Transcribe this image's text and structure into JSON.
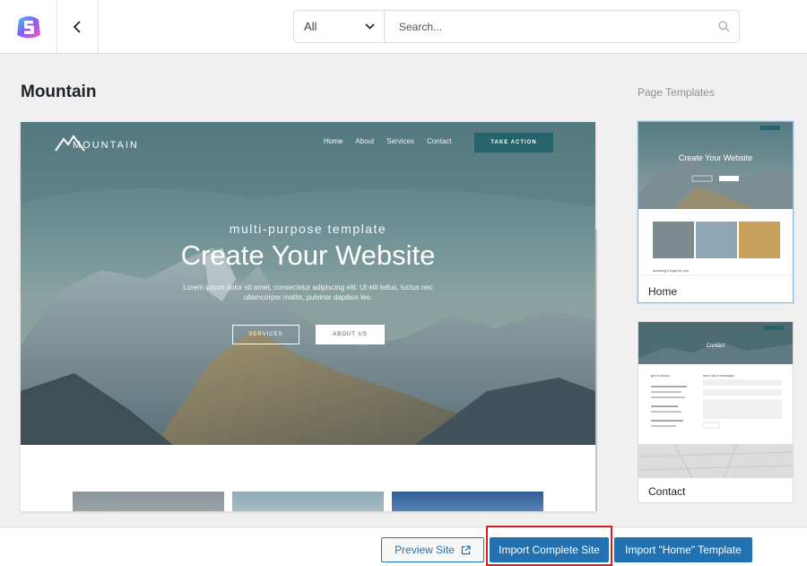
{
  "toolbar": {
    "filter": {
      "selected": "All"
    },
    "search": {
      "placeholder": "Search..."
    }
  },
  "page_title": "Mountain",
  "sidebar": {
    "heading": "Page Templates",
    "templates": [
      {
        "label": "Home",
        "selected": true
      },
      {
        "label": "Contact",
        "selected": false
      }
    ]
  },
  "preview": {
    "logo_text": "MOUNTAIN",
    "nav": [
      "Home",
      "About",
      "Services",
      "Contact"
    ],
    "cta": "TAKE ACTION",
    "kicker": "multi-purpose template",
    "title": "Create Your Website",
    "body": "Lorem ipsum dolor sit amet, consectetur adipiscing elit. Ut elit tellus, luctus nec ullamcorper mattis, pulvinar dapibus leo.",
    "buttons": [
      "SERVICES",
      "ABOUT US"
    ]
  },
  "thumb_home": {
    "title": "Create Your Website",
    "caption": "amazing things for you"
  },
  "thumb_contact": {
    "title": "Contact",
    "col1": "get in touch",
    "col2": "send us a message"
  },
  "footer": {
    "preview_label": "Preview Site",
    "import_label": "Import Complete Site",
    "import_home_label": "Import \"Home\" Template"
  },
  "colors": {
    "accent": "#2271b1",
    "highlight": "#d62026",
    "hero_cta": "#27636a"
  }
}
